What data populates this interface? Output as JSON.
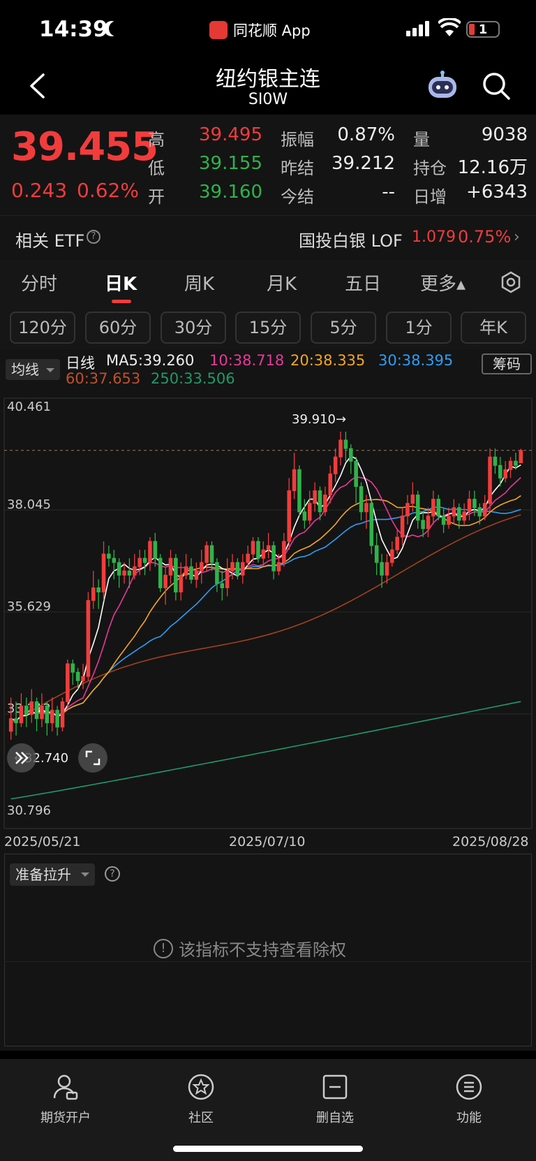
{
  "status": {
    "time": "14:39",
    "app_name": "同花顺 App",
    "battery": "1"
  },
  "header": {
    "title": "纽约银主连",
    "code": "SI0W"
  },
  "quote": {
    "price": "39.455",
    "change": "0.243",
    "change_pct": "0.62%",
    "fields": [
      {
        "label": "高",
        "value": "39.495",
        "color": "red"
      },
      {
        "label": "低",
        "value": "39.155",
        "color": "green"
      },
      {
        "label": "开",
        "value": "39.160",
        "color": "green"
      },
      {
        "label": "振幅",
        "value": "0.87%",
        "color": "white"
      },
      {
        "label": "昨结",
        "value": "39.212",
        "color": "white"
      },
      {
        "label": "今结",
        "value": "--",
        "color": "white"
      },
      {
        "label": "量",
        "value": "9038",
        "color": "white"
      },
      {
        "label": "持仓",
        "value": "12.16万",
        "color": "white"
      },
      {
        "label": "日增",
        "value": "+6343",
        "color": "white"
      }
    ]
  },
  "etf": {
    "label": "相关 ETF",
    "help": "?",
    "name": "国投白银 LOF",
    "price": "1.079",
    "pct": "0.75%",
    "arrow": "›"
  },
  "tabs": [
    {
      "label": "分时"
    },
    {
      "label": "日K"
    },
    {
      "label": "周K"
    },
    {
      "label": "月K"
    },
    {
      "label": "五日"
    },
    {
      "label": "更多▴"
    }
  ],
  "periods": [
    "120分",
    "60分",
    "30分",
    "15分",
    "5分",
    "1分",
    "年K"
  ],
  "ma": {
    "selector": "均线",
    "prefix": "日线",
    "ma5": "MA5:39.260",
    "ma10": "10:38.718",
    "ma20": "20:38.335",
    "ma30": "30:38.395",
    "ma60": "60:37.653",
    "ma250": "250:33.506",
    "chips_label": "筹码",
    "colors": {
      "ma5": "#ffffff",
      "ma10": "#e8389a",
      "ma20": "#f5a623",
      "ma30": "#2d9ef5",
      "ma60": "#a0421a",
      "ma250": "#1f9a6a"
    }
  },
  "chart_data": {
    "type": "candlestick",
    "y_ticks": [
      "40.461",
      "38.045",
      "35.629",
      "33.212",
      "30.796"
    ],
    "ylim": [
      30.796,
      40.461
    ],
    "max_label": "39.910→",
    "min_label": "←32.740",
    "ref_line": 39.455,
    "x_labels": [
      "2025/05/21",
      "2025/07/10",
      "2025/08/28"
    ],
    "candles": [
      [
        32.8,
        33.1,
        33.6,
        32.6
      ],
      [
        33.1,
        33.0,
        33.5,
        32.7
      ],
      [
        33.0,
        33.4,
        33.7,
        32.9
      ],
      [
        33.4,
        33.2,
        33.6,
        32.9
      ],
      [
        33.2,
        33.5,
        33.8,
        33.0
      ],
      [
        33.5,
        33.1,
        33.6,
        32.8
      ],
      [
        33.1,
        33.4,
        33.7,
        32.9
      ],
      [
        33.4,
        33.0,
        33.5,
        32.7
      ],
      [
        33.0,
        33.3,
        33.6,
        32.8
      ],
      [
        33.3,
        32.9,
        33.4,
        32.7
      ],
      [
        32.9,
        33.5,
        33.6,
        32.8
      ],
      [
        33.5,
        34.4,
        34.5,
        33.3
      ],
      [
        34.4,
        34.2,
        34.5,
        33.9
      ],
      [
        34.2,
        34.0,
        34.3,
        33.8
      ],
      [
        34.0,
        34.1,
        34.4,
        33.8
      ],
      [
        34.1,
        35.9,
        36.1,
        34.0
      ],
      [
        35.9,
        36.2,
        36.6,
        35.7
      ],
      [
        36.2,
        36.1,
        36.4,
        35.7
      ],
      [
        36.1,
        37.0,
        37.3,
        35.9
      ],
      [
        37.0,
        36.9,
        37.2,
        36.7
      ],
      [
        36.9,
        36.8,
        37.1,
        36.4
      ],
      [
        36.8,
        36.5,
        36.9,
        36.2
      ],
      [
        36.5,
        36.6,
        36.8,
        36.3
      ],
      [
        36.6,
        36.5,
        36.9,
        36.2
      ],
      [
        36.5,
        36.7,
        37.0,
        36.4
      ],
      [
        36.7,
        36.9,
        37.1,
        36.5
      ],
      [
        36.9,
        36.8,
        37.1,
        36.5
      ],
      [
        36.8,
        37.3,
        37.4,
        36.6
      ],
      [
        37.3,
        36.9,
        37.5,
        36.7
      ],
      [
        36.9,
        36.2,
        37.0,
        36.1
      ],
      [
        36.2,
        36.5,
        36.7,
        35.8
      ],
      [
        36.5,
        36.9,
        37.1,
        36.3
      ],
      [
        36.9,
        36.1,
        37.0,
        35.9
      ],
      [
        36.1,
        36.5,
        36.8,
        35.9
      ],
      [
        36.5,
        36.7,
        37.0,
        36.4
      ],
      [
        36.7,
        36.4,
        36.9,
        36.3
      ],
      [
        36.4,
        36.6,
        36.8,
        36.2
      ],
      [
        36.6,
        36.8,
        37.1,
        36.3
      ],
      [
        36.8,
        37.2,
        37.3,
        36.6
      ],
      [
        37.2,
        36.8,
        37.3,
        36.6
      ],
      [
        36.8,
        36.3,
        36.9,
        36.1
      ],
      [
        36.3,
        36.2,
        36.6,
        35.9
      ],
      [
        36.2,
        36.6,
        36.9,
        36.0
      ],
      [
        36.6,
        36.8,
        37.0,
        36.4
      ],
      [
        36.8,
        36.5,
        36.9,
        36.4
      ],
      [
        36.5,
        36.8,
        37.0,
        36.3
      ],
      [
        36.8,
        37.0,
        37.2,
        36.7
      ],
      [
        37.0,
        37.3,
        37.4,
        36.8
      ],
      [
        37.3,
        36.9,
        37.4,
        36.8
      ],
      [
        36.9,
        37.1,
        37.3,
        36.7
      ],
      [
        37.1,
        37.2,
        37.5,
        36.9
      ],
      [
        37.2,
        36.6,
        37.3,
        36.4
      ],
      [
        36.6,
        36.8,
        37.0,
        36.5
      ],
      [
        36.8,
        37.3,
        37.5,
        36.7
      ],
      [
        37.3,
        38.5,
        38.8,
        37.1
      ],
      [
        38.5,
        39.0,
        39.4,
        38.3
      ],
      [
        39.0,
        38.0,
        39.1,
        37.9
      ],
      [
        38.0,
        37.8,
        38.3,
        37.6
      ],
      [
        37.8,
        38.2,
        38.5,
        37.7
      ],
      [
        38.2,
        38.5,
        38.7,
        38.0
      ],
      [
        38.5,
        38.0,
        38.6,
        37.8
      ],
      [
        38.0,
        38.4,
        38.6,
        37.9
      ],
      [
        38.4,
        38.9,
        39.1,
        38.2
      ],
      [
        38.9,
        39.3,
        39.5,
        38.7
      ],
      [
        39.3,
        39.7,
        39.9,
        39.1
      ],
      [
        39.7,
        39.5,
        39.9,
        39.2
      ],
      [
        39.5,
        39.2,
        39.6,
        38.9
      ],
      [
        39.2,
        38.6,
        39.3,
        38.2
      ],
      [
        38.6,
        38.0,
        38.7,
        37.8
      ],
      [
        38.0,
        38.2,
        38.4,
        37.6
      ],
      [
        38.2,
        37.2,
        38.3,
        37.0
      ],
      [
        37.2,
        36.8,
        37.5,
        36.5
      ],
      [
        36.8,
        36.5,
        37.0,
        36.2
      ],
      [
        36.5,
        36.8,
        37.0,
        36.3
      ],
      [
        36.8,
        37.1,
        37.3,
        36.7
      ],
      [
        37.1,
        37.4,
        37.6,
        37.0
      ],
      [
        37.4,
        37.9,
        38.1,
        37.2
      ],
      [
        37.9,
        38.2,
        38.4,
        37.7
      ],
      [
        38.2,
        38.4,
        38.7,
        38.0
      ],
      [
        38.4,
        37.8,
        38.5,
        37.6
      ],
      [
        37.8,
        37.6,
        38.0,
        37.4
      ],
      [
        37.6,
        37.9,
        38.1,
        37.4
      ],
      [
        37.9,
        38.3,
        38.5,
        37.7
      ],
      [
        38.3,
        37.9,
        38.4,
        37.8
      ],
      [
        37.9,
        37.7,
        38.1,
        37.5
      ],
      [
        37.7,
        37.9,
        38.1,
        37.6
      ],
      [
        37.9,
        38.1,
        38.3,
        37.7
      ],
      [
        38.1,
        37.8,
        38.2,
        37.6
      ],
      [
        37.8,
        38.0,
        38.2,
        37.7
      ],
      [
        38.0,
        38.3,
        38.5,
        37.8
      ],
      [
        38.3,
        38.1,
        38.5,
        37.9
      ],
      [
        38.1,
        37.9,
        38.2,
        37.7
      ],
      [
        37.9,
        38.2,
        38.4,
        37.8
      ],
      [
        38.2,
        39.3,
        39.5,
        38.0
      ],
      [
        39.3,
        39.1,
        39.5,
        38.9
      ],
      [
        39.1,
        38.8,
        39.3,
        38.6
      ],
      [
        38.8,
        39.0,
        39.2,
        38.7
      ],
      [
        39.0,
        39.2,
        39.3,
        38.8
      ],
      [
        39.2,
        39.1,
        39.4,
        39.0
      ],
      [
        39.16,
        39.455,
        39.495,
        39.155
      ]
    ]
  },
  "indicator": {
    "selector": "准备拉升",
    "help": "?",
    "message": "该指标不支持查看除权",
    "msg_icon": "!"
  },
  "bottom_nav": [
    {
      "label": "期货开户",
      "icon": "account-icon"
    },
    {
      "label": "社区",
      "icon": "community-icon"
    },
    {
      "label": "删自选",
      "icon": "remove-watchlist-icon"
    },
    {
      "label": "功能",
      "icon": "menu-icon"
    }
  ]
}
